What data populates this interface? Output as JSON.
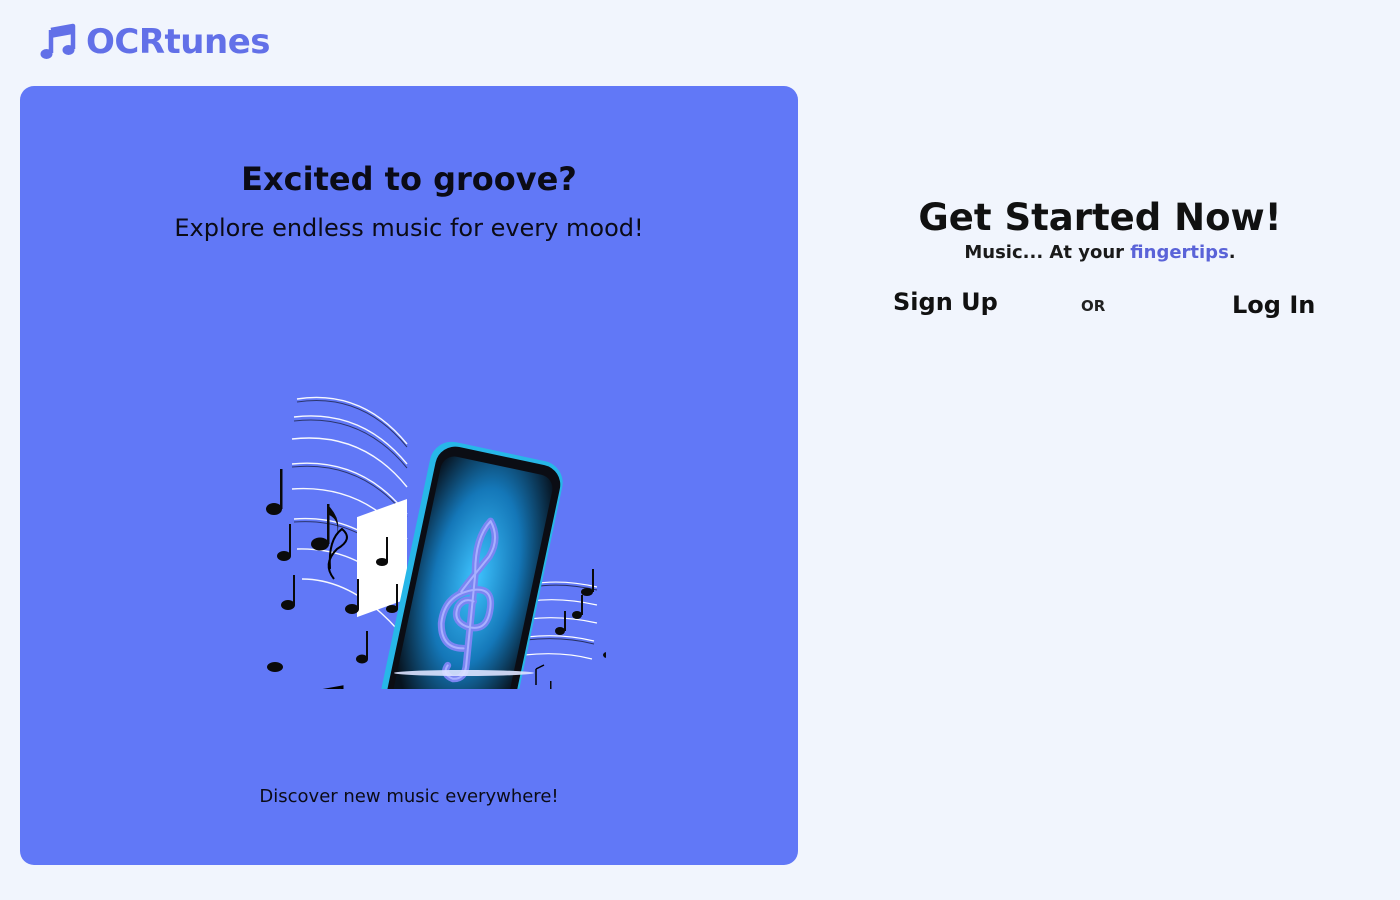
{
  "brand": {
    "name": "OCRtunes",
    "icon": "music-note-icon",
    "color": "#6270e8"
  },
  "hero": {
    "background": "#6178f7",
    "title": "Excited to groove?",
    "subtitle": "Explore endless music for every mood!",
    "image": "phone-with-music-notes-illustration",
    "footer": "Discover new music everywhere!"
  },
  "cta": {
    "title": "Get Started Now!",
    "subtitle_pre": "Music... At your ",
    "subtitle_accent": "fingertips",
    "subtitle_post": ".",
    "accent_color": "#5a63d8",
    "signup_label": "Sign Up",
    "or_label": "OR",
    "login_label": "Log In"
  }
}
